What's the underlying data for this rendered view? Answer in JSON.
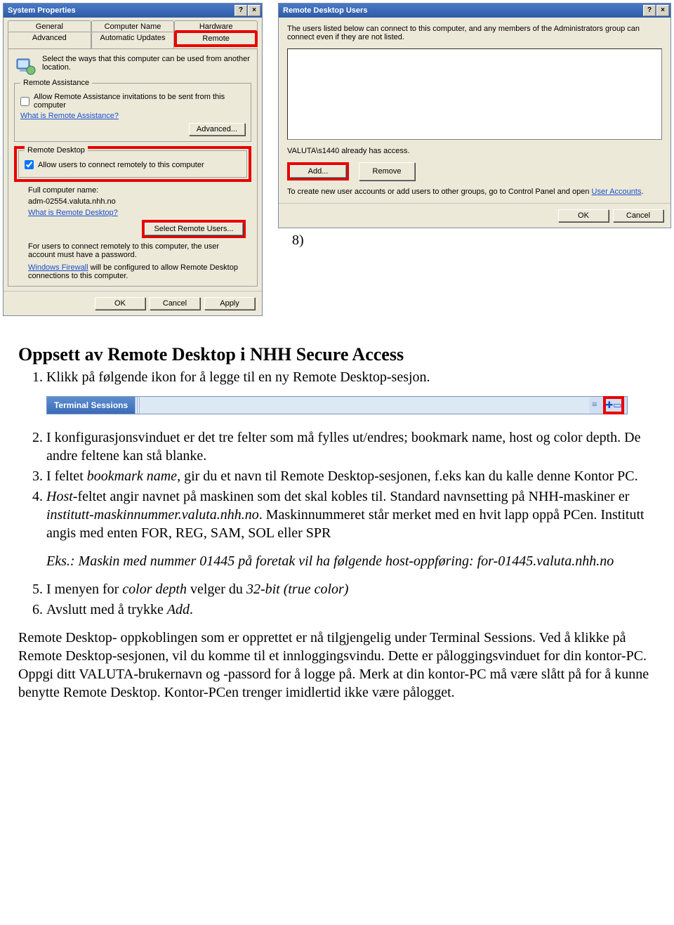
{
  "system_properties": {
    "title": "System Properties",
    "tabs_row1": [
      "General",
      "Computer Name",
      "Hardware"
    ],
    "tabs_row2": [
      "Advanced",
      "Automatic Updates",
      "Remote"
    ],
    "intro": "Select the ways that this computer can be used from another location.",
    "ra_legend": "Remote Assistance",
    "ra_checkbox": "Allow Remote Assistance invitations to be sent from this computer",
    "ra_link": "What is Remote Assistance?",
    "ra_advanced": "Advanced...",
    "rd_legend": "Remote Desktop",
    "rd_checkbox": "Allow users to connect remotely to this computer",
    "rd_fullname_label": "Full computer name:",
    "rd_fullname": "adm-02554.valuta.nhh.no",
    "rd_link": "What is Remote Desktop?",
    "rd_select_btn": "Select Remote Users...",
    "rd_note": "For users to connect remotely to this computer, the user account must have a password.",
    "rd_fw_link": "Windows Firewall",
    "rd_fw_text": " will be configured to allow Remote Desktop connections to this computer.",
    "ok": "OK",
    "cancel": "Cancel",
    "apply": "Apply"
  },
  "remote_users": {
    "title": "Remote Desktop Users",
    "intro": "The users listed below can connect to this computer, and any members of the Administrators group can connect even if they are not listed.",
    "access_line": "VALUTA\\s1440 already has access.",
    "add": "Add...",
    "remove": "Remove",
    "note": "To create new user accounts or add users to other groups, go to Control Panel and open ",
    "ua_link": "User Accounts",
    "ok": "OK",
    "cancel": "Cancel"
  },
  "doc": {
    "step8": "8)",
    "heading": "Oppsett av Remote Desktop i NHH Secure Access",
    "li1": "Klikk på følgende ikon for å legge til en ny Remote Desktop-sesjon.",
    "ts_label": "Terminal Sessions",
    "li2": "I konfigurasjonsvinduet er det tre felter som må fylles ut/endres; bookmark name, host og color depth. De andre feltene kan stå blanke.",
    "li3_a": "I feltet ",
    "li3_b": "bookmark name",
    "li3_c": ", gir du et navn til Remote Desktop-sesjonen, f.eks kan du kalle denne Kontor PC.",
    "li4_a": "Host",
    "li4_b": "-feltet angir navnet på maskinen som det skal kobles til. Standard navnsetting på NHH-maskiner er ",
    "li4_c": "institutt-maskinnummer.valuta.nhh.no",
    "li4_d": ". Maskinnummeret står merket med en hvit lapp oppå PCen. Institutt angis med enten FOR, REG, SAM, SOL eller SPR",
    "example": "Eks.: Maskin med nummer 01445 på foretak vil ha følgende host-oppføring: for-01445.valuta.nhh.no",
    "li5_a": "I menyen for ",
    "li5_b": "color depth",
    "li5_c": " velger du ",
    "li5_d": "32-bit (true color)",
    "li6_a": "Avslutt med å trykke ",
    "li6_b": "Add",
    "li6_c": ".",
    "para_final": "Remote Desktop- oppkoblingen som er opprettet er nå tilgjengelig under Terminal Sessions. Ved å klikke på Remote Desktop-sesjonen, vil du komme til et innloggingsvindu. Dette er påloggingsvinduet for din kontor-PC. Oppgi ditt VALUTA-brukernavn og -passord for å logge på. Merk at din kontor-PC må være slått på for å kunne benytte Remote Desktop. Kontor-PCen trenger imidlertid ikke være pålogget."
  }
}
